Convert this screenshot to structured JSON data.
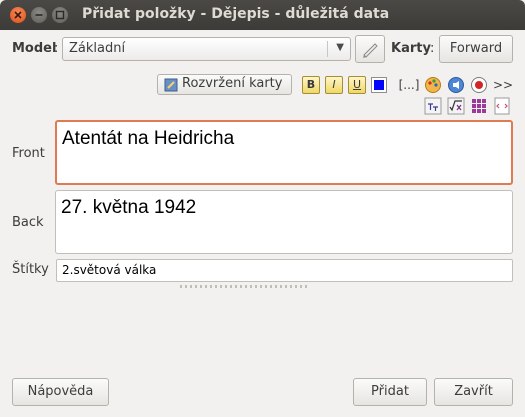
{
  "window": {
    "title": "Přidat položky - Dějepis - důležitá data"
  },
  "model": {
    "label": "Model",
    "colon": ":",
    "selected": "Základní"
  },
  "cards": {
    "label": "Karty",
    "colon": ":",
    "forward_label": "Forward"
  },
  "toolbar": {
    "layout_label": "Rozvržení karty",
    "bold": "B",
    "italic": "I",
    "underline": "U",
    "cloze": "[...]",
    "more": ">>"
  },
  "fields": [
    {
      "name": "Front",
      "value": "Atentát na Heidricha"
    },
    {
      "name": "Back",
      "value": "27. května 1942"
    }
  ],
  "tags": {
    "label": "Štítky",
    "value": "2.světová válka"
  },
  "buttons": {
    "help": "Nápověda",
    "add": "Přidat",
    "close": "Zavřít"
  },
  "colors": {
    "accent_focus": "#e07a52",
    "text_color_swatch": "#0000ff",
    "titlebar": "#3c3b37"
  },
  "icons": [
    "close-icon",
    "minimize-icon",
    "maximize-icon",
    "dropdown-arrow-icon",
    "pencil-icon",
    "card-layout-icon",
    "text-color-icon",
    "palette-icon",
    "attach-icon",
    "record-icon",
    "latex-icon",
    "math-icon",
    "table-icon",
    "html-icon"
  ]
}
